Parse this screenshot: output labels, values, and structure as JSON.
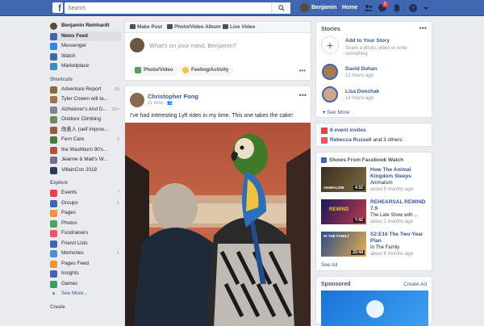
{
  "topbar": {
    "search_placeholder": "Search",
    "user_name": "Benjamin",
    "home_label": "Home",
    "notification_count": "1"
  },
  "left_nav": {
    "profile_name": "Benjamin Reinhardt",
    "main_items": [
      {
        "label": "News Feed",
        "count": "",
        "color": "#4267b2"
      },
      {
        "label": "Messenger",
        "count": "",
        "color": "#1c8ef9"
      },
      {
        "label": "Watch",
        "count": "",
        "color": "#4267b2"
      },
      {
        "label": "Marketplace",
        "count": "",
        "color": "#3b8cc1"
      }
    ],
    "shortcuts_header": "Shortcuts",
    "shortcuts": [
      {
        "label": "Adventure Report",
        "count": "16",
        "color": "#8b6b3e"
      },
      {
        "label": "Tyler Cowen will ta...",
        "count": "",
        "color": "#a07050"
      },
      {
        "label": "Alzheimer's And D...",
        "count": "20+",
        "color": "#7d8896"
      },
      {
        "label": "Outdoor Climbing",
        "count": "",
        "color": "#6b8a5a"
      },
      {
        "label": "改善人 (self improv...",
        "count": "",
        "color": "#9a5a4a"
      },
      {
        "label": "Fern Care",
        "count": "3",
        "color": "#4a7a3a"
      },
      {
        "label": "the Washburn 90's...",
        "count": "",
        "color": "#b0553a"
      },
      {
        "label": "Jeanne & Matt's W...",
        "count": "",
        "color": "#7a6a8a"
      },
      {
        "label": "VillainCon 2018",
        "count": "",
        "color": "#2a3a5a"
      }
    ],
    "explore_header": "Explore",
    "explore": [
      {
        "label": "Events",
        "count": "7",
        "color": "#e4434a"
      },
      {
        "label": "Groups",
        "count": "1",
        "color": "#4267b2"
      },
      {
        "label": "Pages",
        "count": "",
        "color": "#f7923a"
      },
      {
        "label": "Photos",
        "count": "",
        "color": "#4ca65a"
      },
      {
        "label": "Fundraisers",
        "count": "",
        "color": "#f25268"
      },
      {
        "label": "Friend Lists",
        "count": "",
        "color": "#4267b2"
      },
      {
        "label": "Memories",
        "count": "1",
        "color": "#4a90d9"
      },
      {
        "label": "Pages Feed",
        "count": "",
        "color": "#f7923a"
      },
      {
        "label": "Insights",
        "count": "",
        "color": "#4267b2"
      },
      {
        "label": "Games",
        "count": "",
        "color": "#3a9a6a"
      }
    ],
    "see_more": "See More...",
    "create_header": "Create"
  },
  "composer": {
    "tabs": [
      "Make Post",
      "Photo/Video Album",
      "Live Video"
    ],
    "placeholder": "What's on your mind, Benjamin?",
    "photo_video": "Photo/Video",
    "feeling": "Feeling/Activity",
    "more": "•••"
  },
  "post": {
    "author": "Christopher Fong",
    "time": "21 mins",
    "text": "I've had interesting Lyft rides in my time. This one takes the cake!",
    "more": "•••"
  },
  "stories": {
    "title": "Stories",
    "more": "•••",
    "add_title": "Add to Your Story",
    "add_subtitle": "Share a photo, video or write something",
    "items": [
      {
        "name": "David Dohan",
        "time": "12 hours ago"
      },
      {
        "name": "Lisa Donchak",
        "time": "14 hours ago"
      }
    ],
    "see_more": "See More"
  },
  "events": {
    "invites": "8 event invites",
    "birthdays_name": "Rebecca Russell",
    "birthdays_rest": "and 3 others"
  },
  "watch": {
    "title": "Shows From Facebook Watch",
    "items": [
      {
        "title": "How The Animal Kingdom Sleeps",
        "show": "Animalism",
        "time": "about 8 months ago",
        "duration": "4:32",
        "thumb_label": "ANIMALISM"
      },
      {
        "title": "REHEARSAL REWIND 7.9",
        "show": "The Late Show with ...",
        "time": "about 2 months ago",
        "duration": "7:42",
        "thumb_label": "REWIND"
      },
      {
        "title": "S2:E16 The Two-Year Plan",
        "show": "In The Family",
        "time": "about 8 months ago",
        "duration": "22:44",
        "thumb_label": "IN THE FAMILY"
      }
    ],
    "see_all": "See All"
  },
  "sponsored": {
    "label": "Sponsored",
    "create_ad": "Create Ad"
  }
}
